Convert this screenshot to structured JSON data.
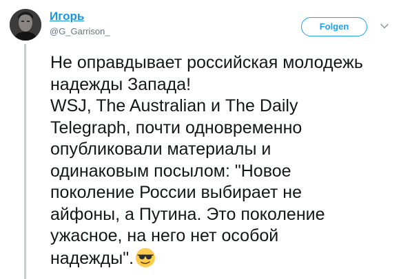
{
  "author": {
    "display_name": "Игорь",
    "handle": "@G_Garrison_"
  },
  "follow_label": "Folgen",
  "tweet": {
    "lines": [
      "Не оправдывает российская молодежь",
      "надежды Запада!",
      "WSJ, The Australian и The Daily",
      "Telegraph, почти одновременно",
      "опубликовали материалы и",
      "одинаковым посылом:  \"Новое",
      "поколение России выбирает не",
      "айфоны, а Путина. Это поколение",
      "ужасное, на него нет особой",
      "надежды\"."
    ],
    "emoji": "smiling-face-with-sunglasses"
  },
  "colors": {
    "link": "#1b95e0",
    "follow": "#1da1f2",
    "handle": "#657786",
    "text": "#14171a",
    "thread_line": "#c4cfd6"
  }
}
